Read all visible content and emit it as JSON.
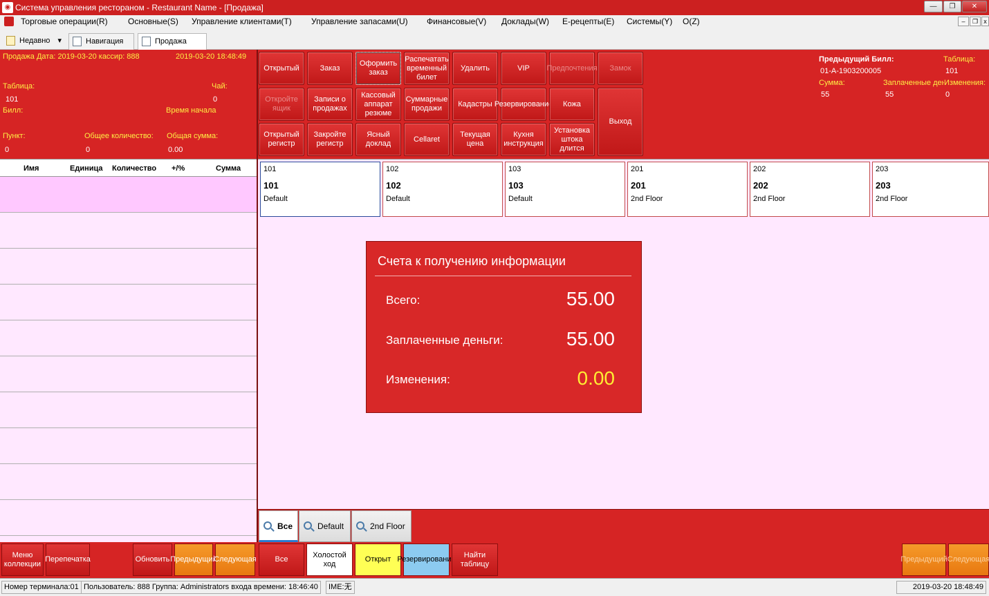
{
  "window": {
    "title": "Система управления рестораном  - Restaurant Name - [Продажа]",
    "minimize": "—",
    "restore": "❐",
    "close": "✕"
  },
  "menu": {
    "items": [
      "Торговые операции(R)",
      "Основные(S)",
      "Управление клиентами(T)",
      "Управление запасами(U)",
      "Финансовые(V)",
      "Доклады(W)",
      "Е-рецепты(E)",
      "Системы(Y)",
      "O(Z)"
    ]
  },
  "tabs": {
    "recent": "Недавно",
    "nav": "Навигация",
    "sale": "Продажа"
  },
  "info": {
    "sale_line": "Продажа Дата: 2019-03-20 кассир: 888",
    "datetime": "2019-03-20 18:48:49",
    "table_label": "Таблица:",
    "table_value": "101",
    "tea_label": "Чай:",
    "tea_value": "0",
    "bill_label": "Билл:",
    "start_label": "Время начала",
    "point_label": "Пункт:",
    "point_value": "0",
    "qty_label": "Общее количество:",
    "qty_value": "0",
    "sum_label": "Общая сумма:",
    "sum_value": "0.00"
  },
  "grid": {
    "headers": [
      "Имя",
      "Единица",
      "Количество",
      "+/%",
      "Сумма"
    ]
  },
  "func_buttons": {
    "row1": [
      "Открытый",
      "Заказ",
      "Оформить заказ",
      "Распечатать временный билет",
      "Удалить",
      "VIP",
      "Предпочтения",
      "Замок"
    ],
    "row2": [
      "Откройте ящик",
      "Записи о продажах",
      "Кассовый аппарат резюме",
      "Суммарные продажи",
      "Кадастры",
      "Резервирование",
      "Кожа"
    ],
    "row3": [
      "Открытый регистр",
      "Закройте регистр",
      "Ясный доклад",
      "Cellaret",
      "Текущая цена",
      "Кухня инструкция",
      "Установка штока длится"
    ],
    "exit": "Выход"
  },
  "right_info": {
    "prev_bill_label": "Предыдущий Билл:",
    "prev_bill_value": "01-A-1903200005",
    "table_label": "Таблица:",
    "table_value": "101",
    "sum_label": "Сумма:",
    "sum_value": "55",
    "paid_label": "Заплаченные ден",
    "paid_value": "55",
    "change_label": "Изменения:",
    "change_value": "0"
  },
  "tables": [
    {
      "code": "101",
      "name": "101",
      "area": "Default"
    },
    {
      "code": "102",
      "name": "102",
      "area": "Default"
    },
    {
      "code": "103",
      "name": "103",
      "area": "Default"
    },
    {
      "code": "201",
      "name": "201",
      "area": "2nd Floor"
    },
    {
      "code": "202",
      "name": "202",
      "area": "2nd Floor"
    },
    {
      "code": "203",
      "name": "203",
      "area": "2nd Floor"
    }
  ],
  "popup": {
    "title": "Счета к получению информации",
    "total_label": "Всего:",
    "total_value": "55.00",
    "paid_label": "Заплаченные деньги:",
    "paid_value": "55.00",
    "change_label": "Изменения:",
    "change_value": "0.00"
  },
  "filters": [
    "Все",
    "Default",
    "2nd Floor"
  ],
  "bottom": {
    "menu_collection": "Меню коллекции",
    "reprint": "Перепечатка",
    "refresh": "Обновить",
    "prev": "Предыдущий",
    "next": "Следующая",
    "all": "Все",
    "idle": "Холостой ход",
    "open": "Открыт",
    "reserve": "Резервирование",
    "find_table": "Найти таблицу",
    "prev_right": "Предыдущий",
    "next_right": "Следующая"
  },
  "status": {
    "terminal": "Номер терминала:01",
    "user": "Пользователь: 888 Группа: Administrators входа времени: 18:46:40",
    "ime": "IME:无",
    "datetime": "2019-03-20 18:48:49"
  }
}
